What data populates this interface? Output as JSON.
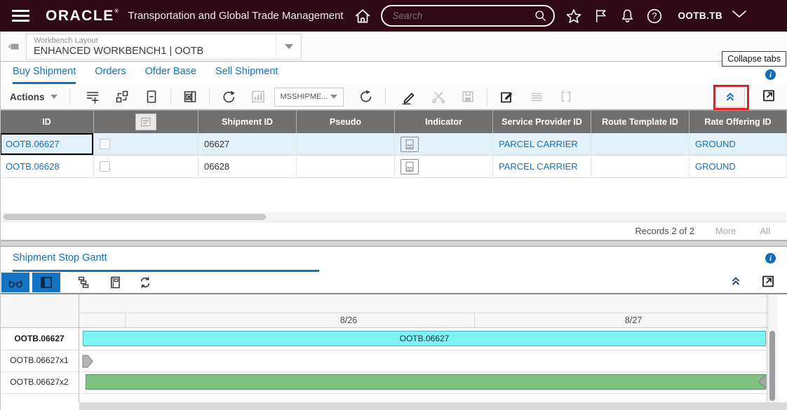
{
  "header": {
    "brand": "ORACLE",
    "title": "Transportation and Global Trade Management",
    "search_placeholder": "Search",
    "user": "OOTB.TB",
    "help_glyph": "?",
    "info_glyph": "i"
  },
  "workbench": {
    "label": "Workbench Layout",
    "value": "ENHANCED WORKBENCH1 | OOTB"
  },
  "tabs": {
    "items": [
      "Buy Shipment",
      "Orders",
      "Ofder Base",
      "Sell Shipment"
    ],
    "active": "Buy Shipment",
    "collapse_tooltip": "Collapse tabs"
  },
  "toolbar": {
    "actions": "Actions",
    "view_select": "MSSHIPME..."
  },
  "shipments_table": {
    "columns": {
      "id": "ID",
      "shipment_id": "Shipment ID",
      "pseudo": "Pseudo",
      "indicator": "Indicator",
      "service_provider": "Service Provider ID",
      "route_template": "Route Template ID",
      "rate_offering": "Rate Offering ID"
    },
    "rows": [
      {
        "id": "OOTB.06627",
        "shipment_id": "06627",
        "pseudo": "",
        "service_provider": "PARCEL CARRIER",
        "route_template": "",
        "rate_offering": "GROUND"
      },
      {
        "id": "OOTB.06628",
        "shipment_id": "06628",
        "pseudo": "",
        "service_provider": "PARCEL CARRIER",
        "route_template": "",
        "rate_offering": "GROUND"
      }
    ],
    "records": "Records 2 of 2",
    "more": "More",
    "all": "All"
  },
  "gantt": {
    "tab": "Shipment Stop Gantt",
    "chart_data": {
      "type": "gantt",
      "time_axis": [
        "8/26",
        "8/27"
      ],
      "rows": [
        {
          "label": "OOTB.06627",
          "bar_label": "OOTB.06627",
          "bar_type": "bar",
          "color": "#7df4f3",
          "span": "full visible range"
        },
        {
          "label": "OOTB.06627x1",
          "bar_type": "milestone",
          "color": "#b7b7b7",
          "position": "start of range"
        },
        {
          "label": "OOTB.06627x2",
          "bar_type": "bar",
          "color": "#80c181",
          "span": "full visible range",
          "end_marker": true
        }
      ]
    }
  },
  "colors": {
    "header_bg": "#2f0a14",
    "accent_blue": "#1273bd",
    "table_header_bg": "#707070",
    "selected_row_bg": "#e2f0fa",
    "gantt_button_bg": "#1474c4",
    "cyan_bar": "#7df4f3",
    "green_bar": "#80c181",
    "annotation_red": "#e41e25"
  }
}
